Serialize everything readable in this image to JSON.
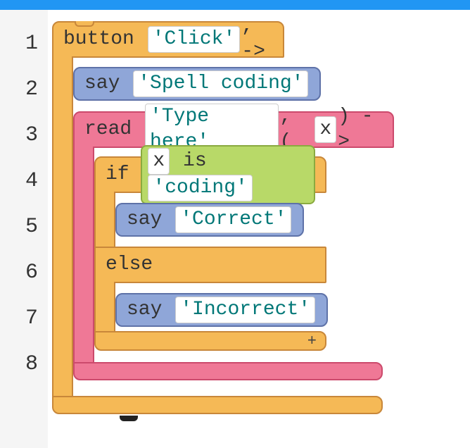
{
  "lineNumbers": [
    "1",
    "2",
    "3",
    "4",
    "5",
    "6",
    "7",
    "8"
  ],
  "blocks": {
    "button": {
      "keyword": "button",
      "label": "'Click'",
      "arrow": ", ->"
    },
    "say1": {
      "keyword": "say",
      "text": "'Spell coding'"
    },
    "read": {
      "keyword": "read",
      "prompt": "'Type here'",
      "comma": ", (",
      "var": "x",
      "arrow": ") ->"
    },
    "if": {
      "keyword": "if",
      "condVar": "x",
      "condOp": " is ",
      "condVal": "'coding'"
    },
    "say2": {
      "keyword": "say",
      "text": "'Correct'"
    },
    "else": {
      "keyword": "else"
    },
    "say3": {
      "keyword": "say",
      "text": "'Incorrect'"
    },
    "add": "+"
  },
  "colors": {
    "orange": "#f5b956",
    "pink": "#ef7896",
    "blue": "#8fa6d8",
    "lime": "#b8d968"
  }
}
